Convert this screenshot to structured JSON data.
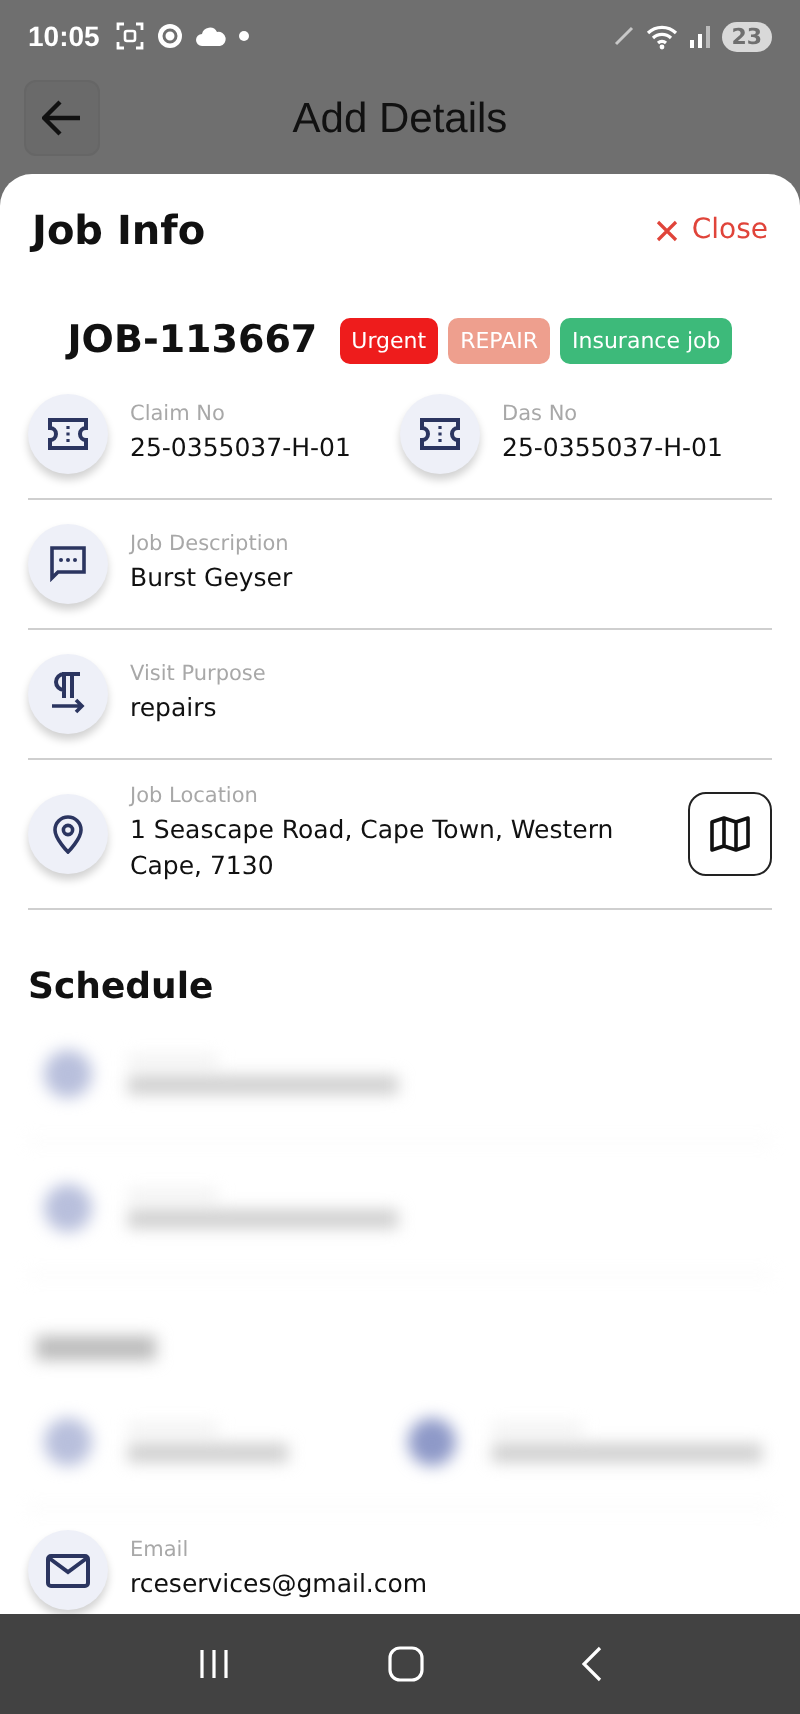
{
  "status_bar": {
    "time": "10:05",
    "battery": "23"
  },
  "header": {
    "title": "Add Details"
  },
  "sheet": {
    "title": "Job Info",
    "close": "Close",
    "job_id": "JOB-113667",
    "tags": [
      {
        "label": "Urgent",
        "color": "#ee1c1c"
      },
      {
        "label": "REPAIR",
        "color": "#ee9f8e"
      },
      {
        "label": "Insurance job",
        "color": "#3dba7a"
      }
    ],
    "rows": [
      {
        "fields": [
          {
            "label": "Claim No",
            "value": "25-0355037-H-01"
          },
          {
            "label": "Das No",
            "value": "25-0355037-H-01"
          }
        ]
      },
      {
        "fields": [
          {
            "label": "Job Description",
            "value": "Burst Geyser"
          }
        ]
      },
      {
        "fields": [
          {
            "label": "Visit Purpose",
            "value": "repairs"
          }
        ]
      },
      {
        "fields": [
          {
            "label": "Job Location",
            "value": "1 Seascape Road, Cape Town, Western Cape, 7130"
          }
        ],
        "map_button": true
      }
    ],
    "schedule_title": "Schedule",
    "email": {
      "label": "Email",
      "value": "rceservices@gmail.com"
    }
  }
}
